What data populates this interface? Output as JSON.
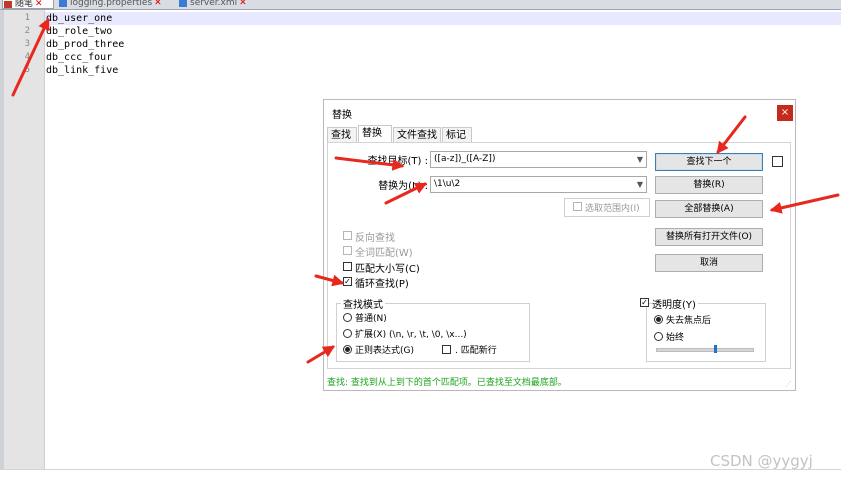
{
  "file_tabs": [
    {
      "label": "随笔",
      "close": "✕",
      "active": true
    },
    {
      "label": "logging.properties",
      "close": "✕",
      "active": false
    },
    {
      "label": "server.xml",
      "close": "✕",
      "active": false
    }
  ],
  "editor": {
    "line_numbers": [
      "1",
      "2",
      "3",
      "4",
      "5"
    ],
    "lines": [
      "db_user_one",
      "db_role_two",
      "db_prod_three",
      "db_ccc_four",
      "db_link_five"
    ]
  },
  "dialog": {
    "title": "替换",
    "close": "×",
    "tabs": [
      "查找",
      "替换",
      "文件查找",
      "标记"
    ],
    "active_tab": "替换",
    "find_label": "查找目标(T) :",
    "find_value": "([a-z])_([A-Z])",
    "replace_label": "替换为(L) :",
    "replace_value": "\\1\\u\\2",
    "in_selection": "选取范围内(I)",
    "buttons": {
      "find_next": "查找下一个",
      "replace": "替换(R)",
      "replace_all": "全部替换(A)",
      "replace_all_open": "替换所有打开文件(O)",
      "cancel": "取消"
    },
    "options": {
      "backward": "反向查找",
      "whole_word": "全词匹配(W)",
      "match_case": "匹配大小写(C)",
      "wrap_around": "循环查找(P)"
    },
    "search_mode": {
      "title": "查找模式",
      "normal": "普通(N)",
      "extended": "扩展(X) (\\n, \\r, \\t, \\0, \\x...)",
      "regex": "正则表达式(G)",
      "dot_newline": ". 匹配新行",
      "selected": "regex"
    },
    "transparency": {
      "label": "透明度(Y)",
      "on_lose_focus": "失去焦点后",
      "always": "始终",
      "checked": true,
      "selected": "on_lose_focus",
      "level": 0.6
    },
    "status": "查找: 查找到从上到下的首个匹配项。已查找至文档最底部。"
  },
  "watermark": "CSDN @yygyj",
  "colors": {
    "arrow": "#e8281e",
    "status": "#1aa41a",
    "close_button": "#c42b1c"
  }
}
